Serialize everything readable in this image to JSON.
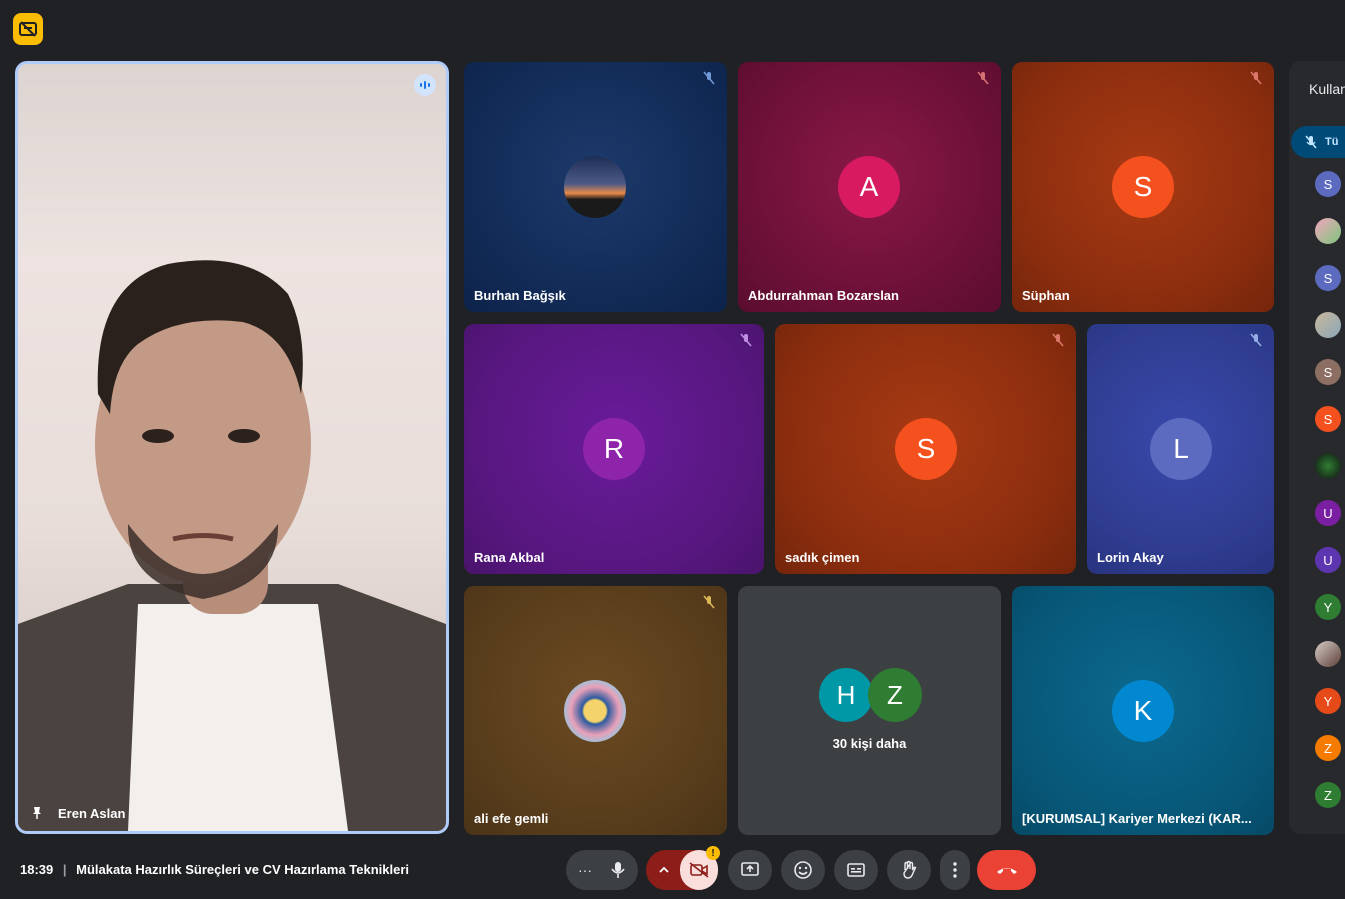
{
  "speaker": {
    "name": "Eren Aslan"
  },
  "tiles": [
    {
      "name": "Burhan Bağşık",
      "initial": ""
    },
    {
      "name": "Abdurrahman Bozarslan",
      "initial": "A"
    },
    {
      "name": "Süphan",
      "initial": "S"
    },
    {
      "name": "Rana Akbal",
      "initial": "R"
    },
    {
      "name": "sadık çimen",
      "initial": "S"
    },
    {
      "name": "Lorin Akay",
      "initial": "L"
    },
    {
      "name": "ali efe gemli",
      "initial": ""
    },
    {
      "name": "[KURUMSAL] Kariyer Merkezi (KAR...",
      "initial": "K"
    }
  ],
  "more": {
    "initials": [
      "H",
      "Z"
    ],
    "label": "30 kişi daha"
  },
  "side": {
    "title": "Kullan",
    "pill": "Tü",
    "avatars": [
      "S",
      "",
      "S",
      "",
      "S",
      "S",
      "",
      "U",
      "U",
      "Y",
      "",
      "Y",
      "Z",
      "Z"
    ]
  },
  "footer": {
    "time": "18:39",
    "separator": "|",
    "meeting_title": "Mülakata Hazırlık Süreçleri ve CV Hazırlama Teknikleri",
    "alert_badge": "!"
  },
  "colors": {
    "accent": "#aecbfa",
    "end_call": "#ea4335",
    "cam_off": "#f9dedc"
  }
}
